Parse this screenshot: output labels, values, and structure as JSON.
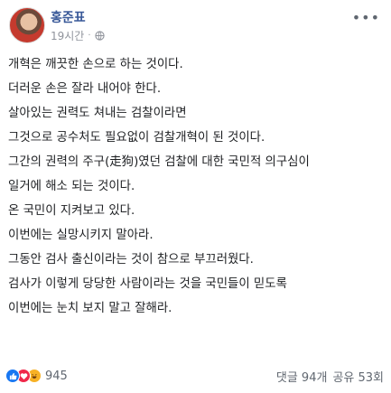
{
  "post": {
    "author": "홍준표",
    "time": "19시간",
    "privacy_icon": "globe-icon",
    "more_icon": "more-options-icon",
    "paragraphs": [
      "개혁은 깨끗한 손으로 하는 것이다.",
      "더러운 손은 잘라 내어야 한다.",
      "살아있는 권력도 쳐내는 검찰이라면",
      "그것으로 공수처도 필요없이 검찰개혁이 된 것이다.",
      "그간의 권력의 주구(走狗)였던 검찰에 대한 국민적 의구심이",
      "일거에 해소 되는 것이다.",
      "온 국민이 지켜보고 있다.",
      "이번에는 실망시키지 말아라.",
      "그동안 검사 출신이라는 것이 참으로 부끄러웠다.",
      "검사가 이렇게 당당한 사람이라는 것을 국민들이 믿도록",
      "이번에는 눈치 보지 말고 잘해라."
    ]
  },
  "footer": {
    "reaction_icons": [
      "like-icon",
      "love-icon",
      "haha-icon"
    ],
    "reaction_count": "945",
    "comments": "댓글 94개",
    "shares": "공유 53회"
  },
  "colors": {
    "author": "#385898",
    "meta": "#90949c",
    "like": "#1877f2",
    "love": "#f0284a",
    "haha": "#f7b125"
  }
}
